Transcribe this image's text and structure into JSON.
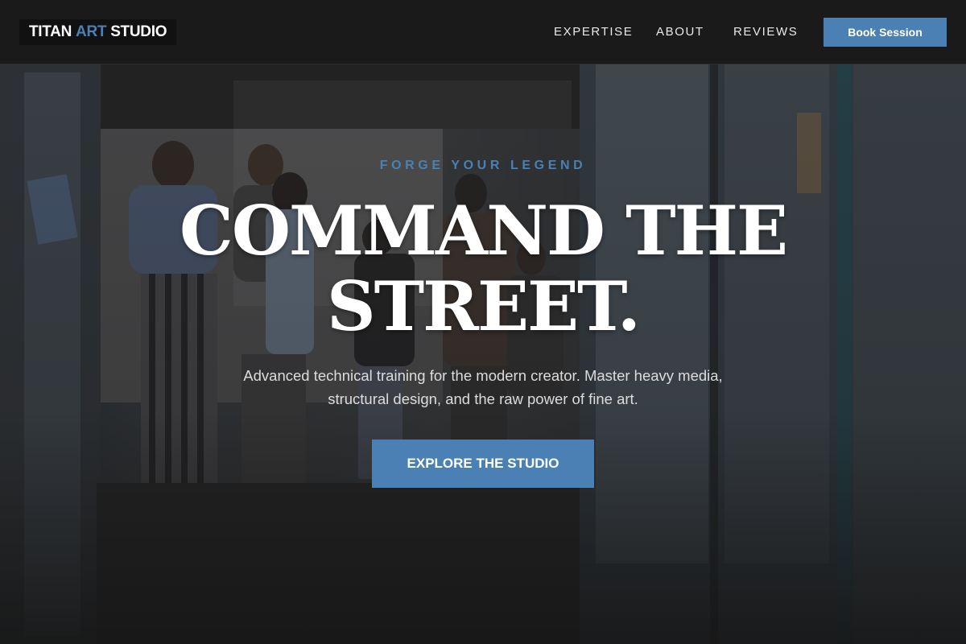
{
  "header": {
    "logo": {
      "part1": "TITAN",
      "part2": "ART",
      "part3": "STUDIO"
    },
    "nav": [
      {
        "label": "EXPERTISE"
      },
      {
        "label": "ABOUT"
      },
      {
        "label": "REVIEWS"
      }
    ],
    "book_button": "Book Session"
  },
  "hero": {
    "eyebrow": "FORGE YOUR LEGEND",
    "headline_line1": "COMMAND THE",
    "headline_line2": "STREET.",
    "subtext": "Advanced technical training for the modern creator. Master heavy media, structural design, and the raw power of fine art.",
    "cta": "EXPLORE THE STUDIO"
  },
  "colors": {
    "accent": "#4a80b3",
    "header_bg": "#1a1a1a",
    "page_bg": "#161616"
  }
}
